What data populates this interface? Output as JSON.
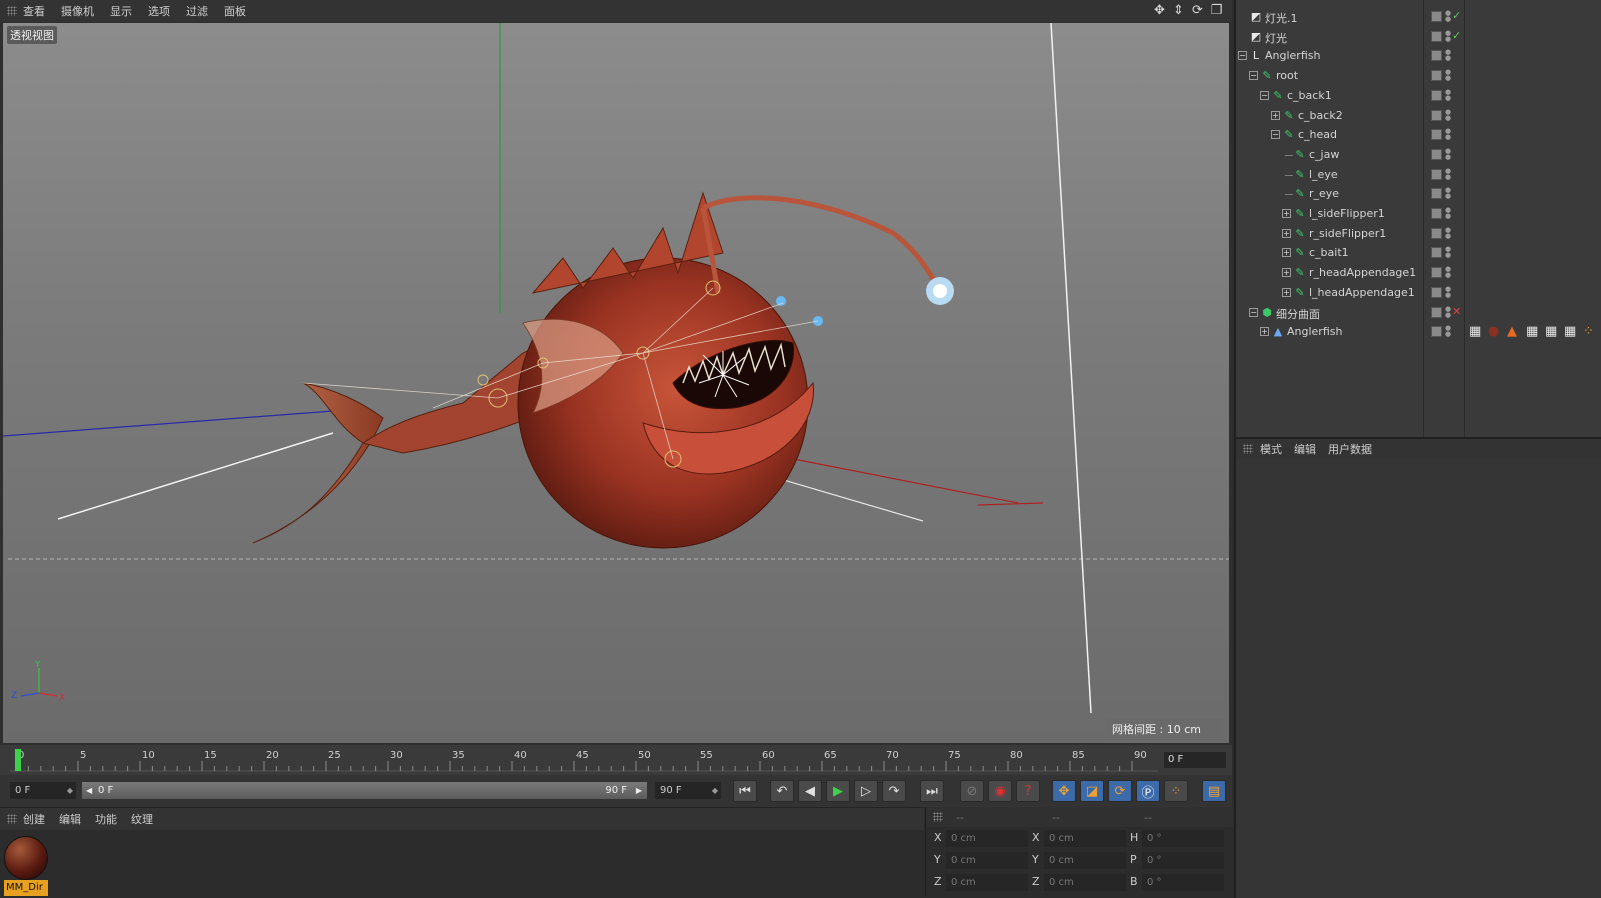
{
  "viewport": {
    "menu": [
      "查看",
      "摄像机",
      "显示",
      "选项",
      "过滤",
      "面板"
    ],
    "view_label": "透视视图",
    "grid_spacing": "网格间距 : 10 cm",
    "axis_labels": {
      "y": "Y",
      "z": "Z",
      "x": "X"
    },
    "tool_icons": [
      "move-view-icon",
      "dolly-view-icon",
      "rotate-view-icon",
      "maximize-view-icon"
    ]
  },
  "timeline": {
    "ticks": [
      "0",
      "5",
      "10",
      "15",
      "20",
      "25",
      "30",
      "35",
      "40",
      "45",
      "50",
      "55",
      "60",
      "65",
      "70",
      "75",
      "80",
      "85",
      "90"
    ],
    "current_frame": "0 F",
    "playhead_frame": 0
  },
  "transport": {
    "start_field": "0 F",
    "range_start": "0 F",
    "range_end": "90 F",
    "end_field": "90 F"
  },
  "material_manager": {
    "menu": [
      "创建",
      "编辑",
      "功能",
      "纹理"
    ],
    "material_name": "MM_Dir"
  },
  "coordinates": {
    "headers": [
      "--",
      "--",
      "--"
    ],
    "rows": [
      {
        "a": "X",
        "av": "0 cm",
        "b": "X",
        "bv": "0 cm",
        "c": "H",
        "cv": "0 °"
      },
      {
        "a": "Y",
        "av": "0 cm",
        "b": "Y",
        "bv": "0 cm",
        "c": "P",
        "cv": "0 °"
      },
      {
        "a": "Z",
        "av": "0 cm",
        "b": "Z",
        "bv": "0 cm",
        "c": "B",
        "cv": "0 °"
      }
    ]
  },
  "object_manager": {
    "objects": [
      {
        "name": "灯光.1",
        "level": 0,
        "icon": "light-icon",
        "expander": "",
        "flag": "✓",
        "flag_color": "#5ccc5c"
      },
      {
        "name": "灯光",
        "level": 0,
        "icon": "light-icon",
        "expander": "",
        "flag": "✓",
        "flag_color": "#5ccc5c"
      },
      {
        "name": "Anglerfish",
        "level": 0,
        "icon": "null-object-icon",
        "expander": "−",
        "flag": "",
        "flag_color": ""
      },
      {
        "name": "root",
        "level": 1,
        "icon": "joint-icon",
        "expander": "−",
        "flag": "",
        "flag_color": ""
      },
      {
        "name": "c_back1",
        "level": 2,
        "icon": "joint-icon",
        "expander": "−",
        "flag": "",
        "flag_color": ""
      },
      {
        "name": "c_back2",
        "level": 3,
        "icon": "joint-icon",
        "expander": "+",
        "flag": "",
        "flag_color": ""
      },
      {
        "name": "c_head",
        "level": 3,
        "icon": "joint-icon",
        "expander": "−",
        "flag": "",
        "flag_color": ""
      },
      {
        "name": "c_jaw",
        "level": 4,
        "icon": "joint-icon",
        "expander": "",
        "flag": "",
        "flag_color": ""
      },
      {
        "name": "l_eye",
        "level": 4,
        "icon": "joint-icon",
        "expander": "",
        "flag": "",
        "flag_color": ""
      },
      {
        "name": "r_eye",
        "level": 4,
        "icon": "joint-icon",
        "expander": "",
        "flag": "",
        "flag_color": ""
      },
      {
        "name": "l_sideFlipper1",
        "level": 4,
        "icon": "joint-icon",
        "expander": "+",
        "flag": "",
        "flag_color": ""
      },
      {
        "name": "r_sideFlipper1",
        "level": 4,
        "icon": "joint-icon",
        "expander": "+",
        "flag": "",
        "flag_color": ""
      },
      {
        "name": "c_bait1",
        "level": 4,
        "icon": "joint-icon",
        "expander": "+",
        "flag": "",
        "flag_color": ""
      },
      {
        "name": "r_headAppendage1",
        "level": 4,
        "icon": "joint-icon",
        "expander": "+",
        "flag": "",
        "flag_color": ""
      },
      {
        "name": "l_headAppendage1",
        "level": 4,
        "icon": "joint-icon",
        "expander": "+",
        "flag": "",
        "flag_color": ""
      },
      {
        "name": "细分曲面",
        "level": 1,
        "icon": "subdivision-surface-icon",
        "expander": "−",
        "flag": "✕",
        "flag_color": "#e04040"
      },
      {
        "name": "Anglerfish",
        "level": 2,
        "icon": "polygon-object-icon",
        "expander": "+",
        "flag": "",
        "flag_color": ""
      }
    ],
    "tag_icons": [
      "checker-tag-icon",
      "material-ball-tag-icon",
      "cone-tag-icon",
      "checker-tag-icon",
      "checker-tag-icon",
      "checker-tag-icon",
      "dots-tag-icon"
    ]
  },
  "attribute_manager": {
    "menu": [
      "模式",
      "编辑",
      "用户数据"
    ]
  }
}
